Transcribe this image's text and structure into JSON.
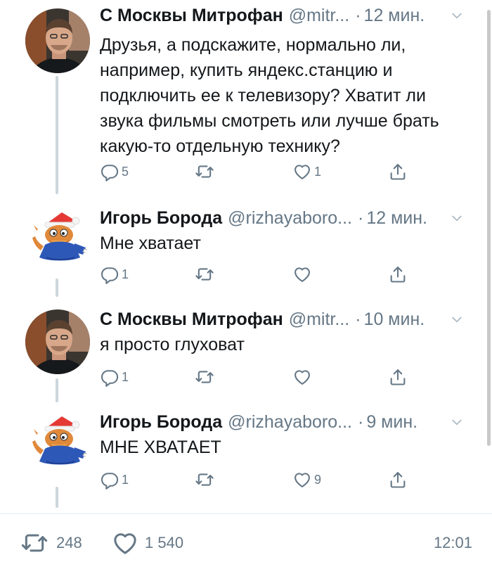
{
  "tweets": [
    {
      "name": "С Москвы Митрофан",
      "handle": "@mitr...",
      "separator": "·",
      "time": "12 мин.",
      "text": "Друзья, а подскажите, нормально ли, например, купить яндекс.станцию и подключить ее к телевизору? Хватит ли звука фильмы смотреть или лучше брать какую-то отдельную технику?",
      "replies": "5",
      "retweets": "",
      "likes": "1"
    },
    {
      "name": "Игорь Борода",
      "handle": "@rizhayaboro...",
      "separator": "·",
      "time": "12 мин.",
      "text": "Мне хватает",
      "replies": "1",
      "retweets": "",
      "likes": ""
    },
    {
      "name": "С Москвы Митрофан",
      "handle": "@mitr...",
      "separator": "·",
      "time": "10 мин.",
      "text": "я просто глуховат",
      "replies": "1",
      "retweets": "",
      "likes": ""
    },
    {
      "name": "Игорь Борода",
      "handle": "@rizhayaboro...",
      "separator": "·",
      "time": "9 мин.",
      "text": "МНЕ ХВАТАЕТ",
      "replies": "1",
      "retweets": "",
      "likes": "9"
    }
  ],
  "footer": {
    "retweets": "248",
    "likes": "1 540",
    "clock": "12:01"
  },
  "colors": {
    "text": "#14171a",
    "muted": "#657786",
    "thread_line": "#ccd6dd"
  },
  "icons": {
    "reply": "reply-icon",
    "retweet": "retweet-icon",
    "like": "heart-icon",
    "share": "share-icon",
    "caret": "chevron-down-icon"
  }
}
